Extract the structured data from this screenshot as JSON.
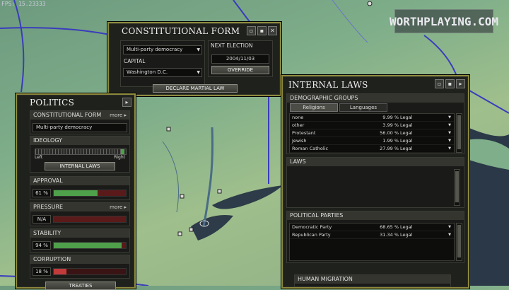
{
  "fps": "FPS: 15.23333",
  "watermark": "WORTHPLAYING.COM",
  "constitutional": {
    "title": "CONSTITUTIONAL FORM",
    "form_value": "Multi-party democracy",
    "capital_label": "CAPITAL",
    "capital_value": "Washington D.C.",
    "next_election_label": "NEXT ELECTION",
    "next_election_value": "2004/11/03",
    "override": "OVERRIDE",
    "martial_law": "DECLARE MARTIAL LAW"
  },
  "politics": {
    "title": "POLITICS",
    "constitutional_form_label": "CONSTITUTIONAL FORM",
    "more": "more ▸",
    "form_value": "Multi-party democracy",
    "ideology_label": "IDEOLOGY",
    "left": "Left",
    "right": "Right",
    "internal_laws_button": "INTERNAL LAWS",
    "approval_label": "APPROVAL",
    "approval_value": "61 %",
    "approval_fraction": 0.61,
    "pressure_label": "PRESSURE",
    "pressure_value": "N/A",
    "pressure_fraction": 0,
    "stability_label": "STABILITY",
    "stability_value": "94 %",
    "stability_fraction": 0.94,
    "corruption_label": "CORRUPTION",
    "corruption_value": "18 %",
    "corruption_fraction": 0.18,
    "treaties_button": "TREATIES"
  },
  "internal": {
    "title": "INTERNAL LAWS",
    "demographic_label": "DEMOGRAPHIC GROUPS",
    "tab_religions": "Religions",
    "tab_languages": "Languages",
    "religions": [
      {
        "name": "none",
        "pct": "9.99 %",
        "status": "Legal"
      },
      {
        "name": "other",
        "pct": "3.99 %",
        "status": "Legal"
      },
      {
        "name": "Protestant",
        "pct": "56.00 %",
        "status": "Legal"
      },
      {
        "name": "Jewish",
        "pct": "1.99 %",
        "status": "Legal"
      },
      {
        "name": "Roman Catholic",
        "pct": "27.99 %",
        "status": "Legal"
      }
    ],
    "laws_label": "LAWS",
    "parties_label": "POLITICAL PARTIES",
    "parties": [
      {
        "name": "Democratic Party",
        "pct": "68.65 %",
        "status": "Legal"
      },
      {
        "name": "Republican Party",
        "pct": "31.34 %",
        "status": "Legal"
      }
    ],
    "migration_label": "HUMAN MIGRATION"
  },
  "colors": {
    "approval_fill": "#4fa04a",
    "stability_fill": "#4fa04a",
    "corruption_fill": "#c23b3b",
    "frame_border": "#8e8a3d"
  }
}
